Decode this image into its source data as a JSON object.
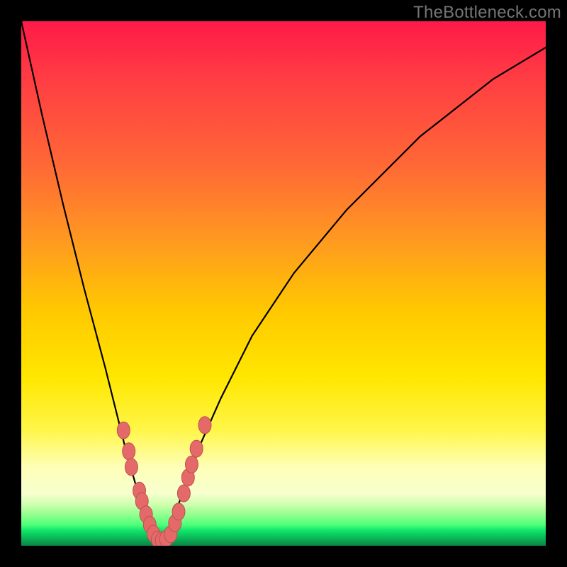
{
  "watermark": "TheBottleneck.com",
  "colors": {
    "background": "#000000",
    "curve": "#000000",
    "marker_fill": "#e46a6a",
    "marker_stroke": "#c14f4f"
  },
  "chart_data": {
    "type": "line",
    "title": "",
    "xlabel": "",
    "ylabel": "",
    "xlim": [
      0,
      100
    ],
    "ylim": [
      0,
      100
    ],
    "note": "Axes unlabeled; values estimated from pixel positions. y=0 at bottom (green), y=100 at top (red). Minimum of the V-curve near x≈26, y≈0.",
    "series": [
      {
        "name": "bottleneck-curve",
        "x": [
          0,
          4,
          8,
          12,
          16,
          20,
          22,
          24,
          25,
          26,
          27,
          28,
          30,
          32,
          34,
          38,
          44,
          52,
          62,
          76,
          90,
          100
        ],
        "y": [
          100,
          82,
          65,
          49,
          34,
          18,
          11,
          5,
          2,
          0.5,
          1,
          3,
          8,
          13,
          19,
          28,
          40,
          52,
          64,
          78,
          89,
          95
        ]
      }
    ],
    "markers": {
      "name": "highlighted-points",
      "note": "Salmon lozenge markers clustered near the valley of the curve.",
      "points": [
        {
          "x": 19.5,
          "y": 22
        },
        {
          "x": 20.5,
          "y": 18
        },
        {
          "x": 21.0,
          "y": 15
        },
        {
          "x": 22.5,
          "y": 10.5
        },
        {
          "x": 23.0,
          "y": 8.5
        },
        {
          "x": 23.8,
          "y": 6
        },
        {
          "x": 24.5,
          "y": 4
        },
        {
          "x": 25.2,
          "y": 2.3
        },
        {
          "x": 26.0,
          "y": 1.2
        },
        {
          "x": 26.8,
          "y": 1.0
        },
        {
          "x": 27.6,
          "y": 1.3
        },
        {
          "x": 28.5,
          "y": 2.2
        },
        {
          "x": 29.3,
          "y": 4.3
        },
        {
          "x": 30.0,
          "y": 6.5
        },
        {
          "x": 31.0,
          "y": 10
        },
        {
          "x": 31.8,
          "y": 13
        },
        {
          "x": 32.5,
          "y": 15.5
        },
        {
          "x": 33.4,
          "y": 18.5
        },
        {
          "x": 35.0,
          "y": 23
        }
      ]
    }
  }
}
